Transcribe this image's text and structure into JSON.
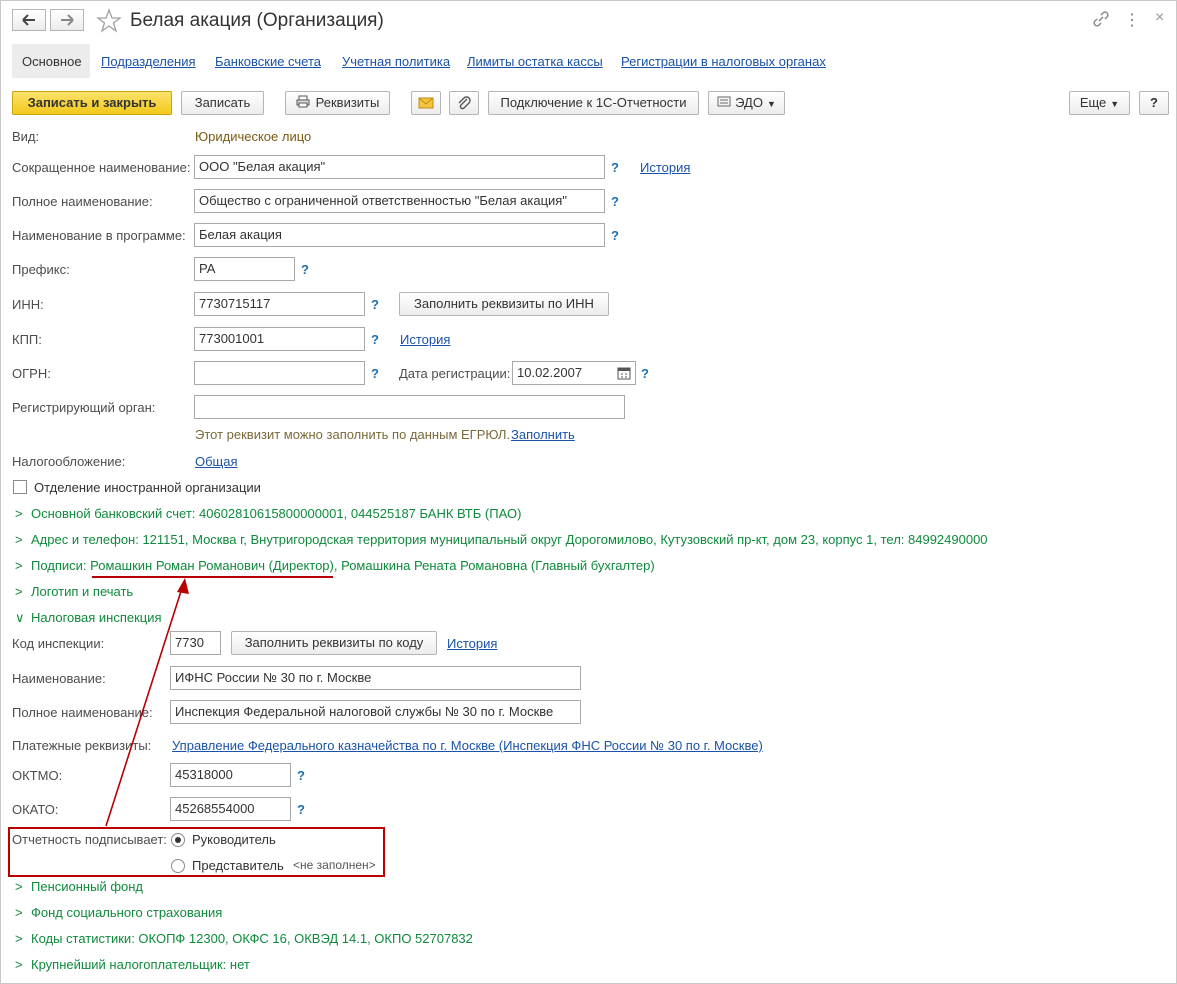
{
  "window": {
    "title": "Белая акация (Организация)"
  },
  "tabs": [
    {
      "label": "Основное",
      "active": true
    },
    {
      "label": "Подразделения"
    },
    {
      "label": "Банковские счета"
    },
    {
      "label": "Учетная политика"
    },
    {
      "label": "Лимиты остатка кассы"
    },
    {
      "label": "Регистрации в налоговых органах"
    }
  ],
  "toolbar": {
    "save_close": "Записать и закрыть",
    "save": "Записать",
    "requisites": "Реквизиты",
    "connect": "Подключение к 1С-Отчетности",
    "edo": "ЭДО",
    "more": "Еще",
    "help": "?"
  },
  "form": {
    "vid_label": "Вид:",
    "vid_value": "Юридическое лицо",
    "short_name_label": "Сокращенное наименование:",
    "short_name": "ООО \"Белая акация\"",
    "full_name_label": "Полное наименование:",
    "full_name": "Общество с ограниченной ответственностью \"Белая акация\"",
    "prog_name_label": "Наименование в программе:",
    "prog_name": "Белая акация",
    "prefix_label": "Префикс:",
    "prefix": "РА",
    "inn_label": "ИНН:",
    "inn": "7730715117",
    "fill_inn": "Заполнить реквизиты по ИНН",
    "kpp_label": "КПП:",
    "kpp": "773001001",
    "ogrn_label": "ОГРН:",
    "ogrn": "",
    "reg_date_label": "Дата регистрации:",
    "reg_date": "10.02.2007",
    "reg_org_label": "Регистрирующий орган:",
    "reg_org": "",
    "egrul_hint": "Этот реквизит можно заполнить по данным ЕГРЮЛ.",
    "egrul_fill": "Заполнить",
    "tax_label": "Налогообложение:",
    "tax_value": "Общая",
    "foreign_label": "Отделение иностранной организации",
    "history": "История",
    "q": "?"
  },
  "groups": {
    "bank": "Основной банковский счет: 40602810615800000001, 044525187 БАНК ВТБ (ПАО)",
    "address": "Адрес и телефон: 121151, Москва г, Внутригородская территория муниципальный округ Дорогомилово, Кутузовский пр-кт, дом 23, корпус 1, тел: 84992490000",
    "sign_prefix": "Подписи: ",
    "sign_director": "Ромашкин Роман Романович (Директор)",
    "sign_rest": ", Ромашкина Рената Романовна (Главный бухгалтер)",
    "logo": "Логотип и печать",
    "tax_inspection": "Налоговая инспекция",
    "pension": "Пенсионный фонд",
    "social": "Фонд социального страхования",
    "stat": "Коды статистики: ОКОПФ 12300, ОКФС 16, ОКВЭД 14.1, ОКПО 52707832",
    "largest": "Крупнейший налогоплательщик: нет"
  },
  "inspection": {
    "code_label": "Код инспекции:",
    "code": "7730",
    "fill_code": "Заполнить реквизиты по коду",
    "name_label": "Наименование:",
    "name": "ИФНС России № 30 по г. Москве",
    "full_label": "Полное наименование:",
    "full": "Инспекция Федеральной налоговой службы № 30 по г. Москве",
    "pay_label": "Платежные реквизиты:",
    "pay": "Управление Федерального казначейства по г. Москве (Инспекция ФНС России № 30 по г. Москве)",
    "oktmo_label": "ОКТМО:",
    "oktmo": "45318000",
    "okato_label": "ОКАТО:",
    "okato": "45268554000",
    "signer_label": "Отчетность подписывает:",
    "opt_head": "Руководитель",
    "opt_rep": "Представитель",
    "rep_empty": "<не заполнен>"
  },
  "colors": {
    "accent_green": "#0f8a3c",
    "link_blue": "#1a52a8",
    "annotation_red": "#b80000"
  }
}
